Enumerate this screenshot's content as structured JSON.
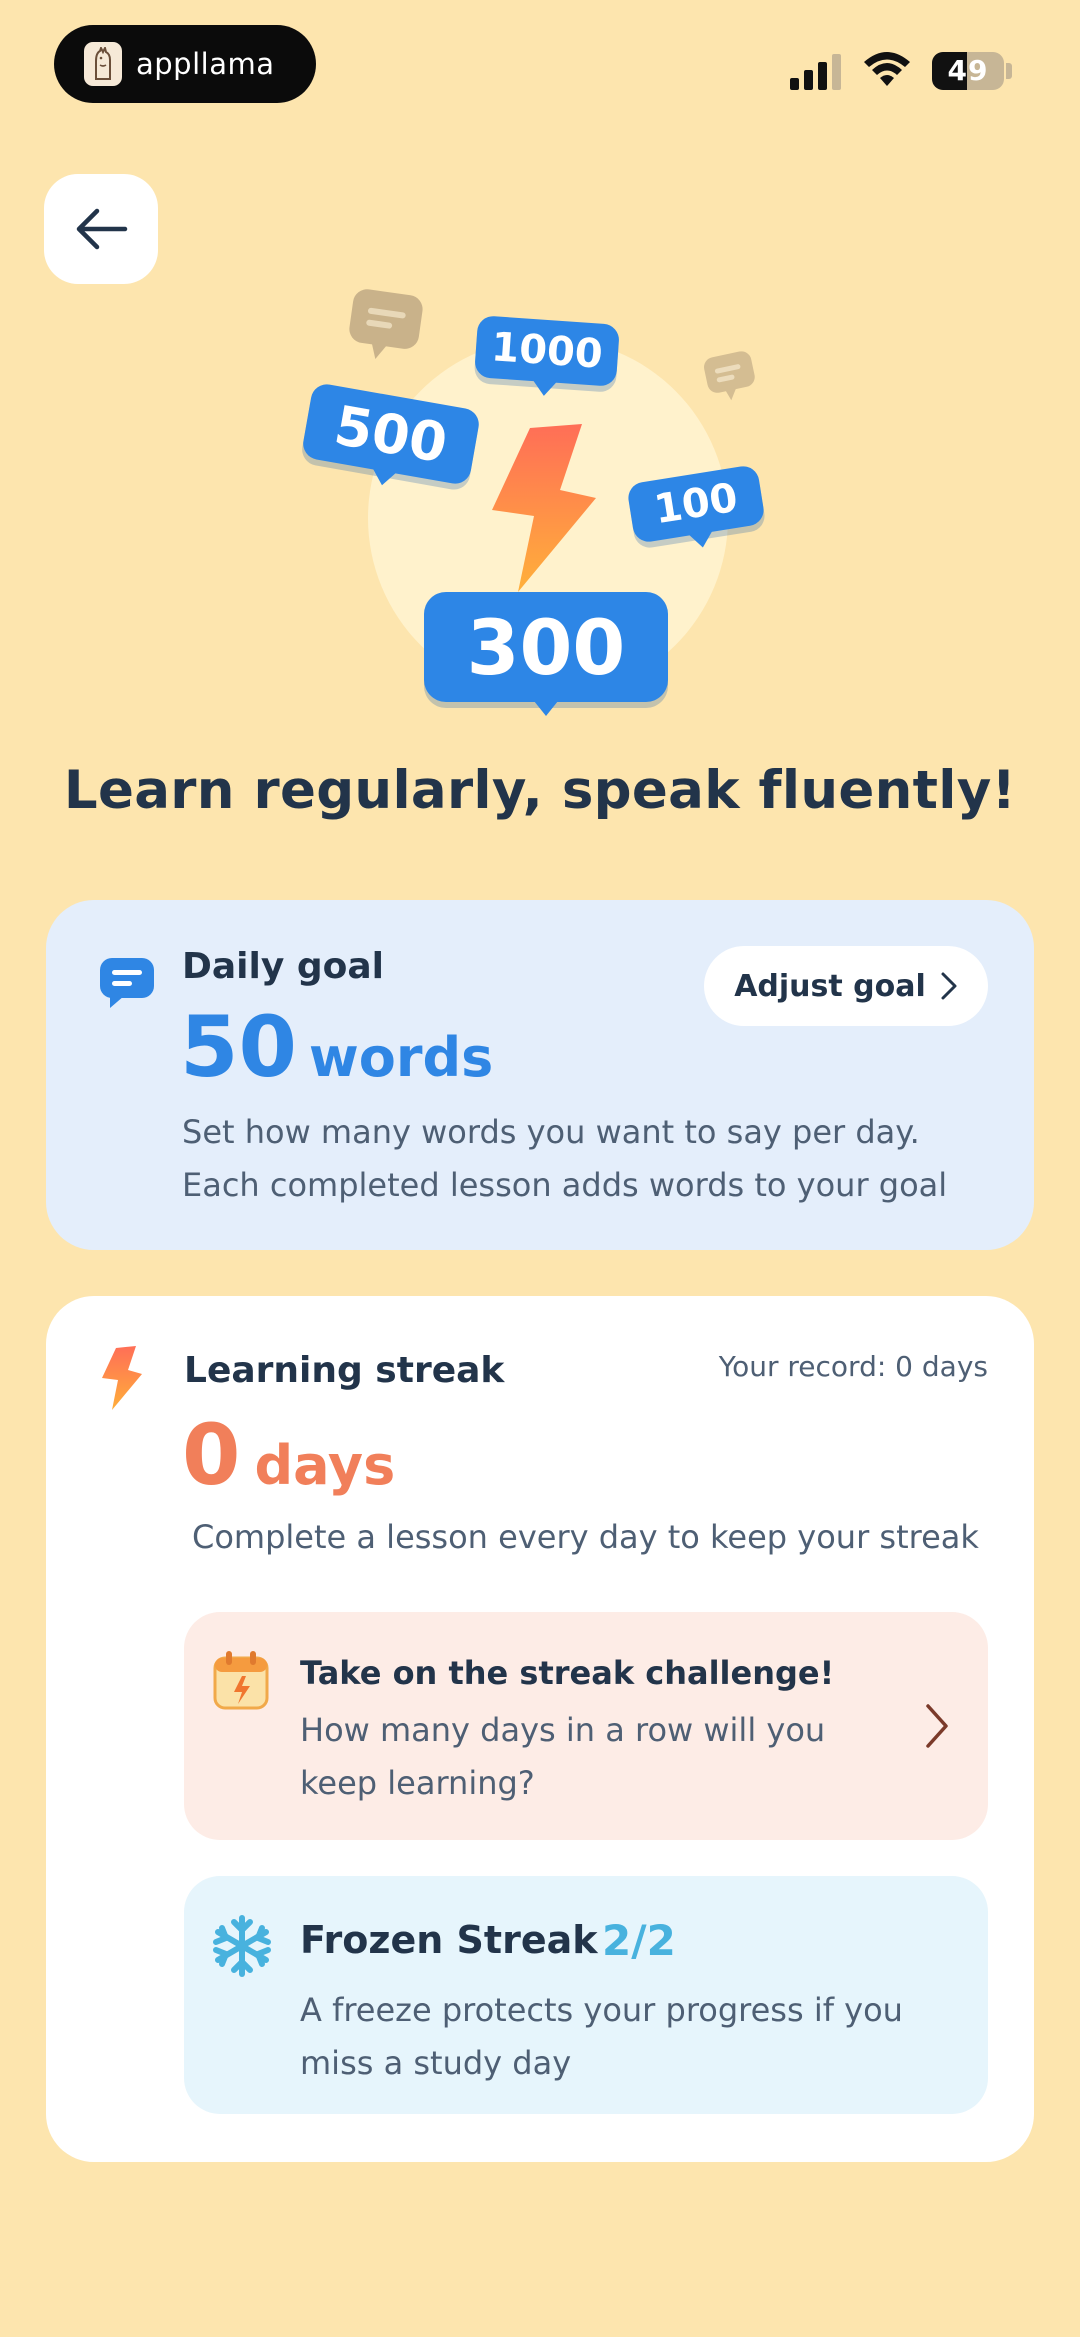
{
  "status_bar": {
    "app_name": "appllama",
    "battery_level": "49",
    "battery_fraction": 0.49
  },
  "hero": {
    "bubbles": [
      "1000",
      "500",
      "100",
      "300"
    ],
    "title": "Learn regularly, speak fluently!"
  },
  "daily_goal": {
    "label": "Daily goal",
    "value": "50",
    "unit": "words",
    "description": "Set how many words you want to say per day. Each completed lesson adds words to your goal",
    "adjust_label": "Adjust goal"
  },
  "streak": {
    "label": "Learning streak",
    "record": "Your record: 0 days",
    "value": "0",
    "unit": "days",
    "description": "Complete a lesson every day to keep your streak",
    "challenge": {
      "title": "Take on the streak challenge!",
      "description": "How many days in a row will you keep learning?"
    },
    "freeze": {
      "title": "Frozen Streak",
      "count": "2/2",
      "description": "A freeze protects your progress if you miss a study day"
    }
  },
  "colors": {
    "background": "#fde5ae",
    "primary_blue": "#2f86e4",
    "streak_orange": "#f17f5a",
    "freeze_blue": "#48b2de",
    "text_dark": "#22344a"
  },
  "icons": [
    "back-arrow-icon",
    "chat-bubble-icon",
    "lightning-icon",
    "calendar-icon",
    "snowflake-icon",
    "chevron-right-icon"
  ]
}
